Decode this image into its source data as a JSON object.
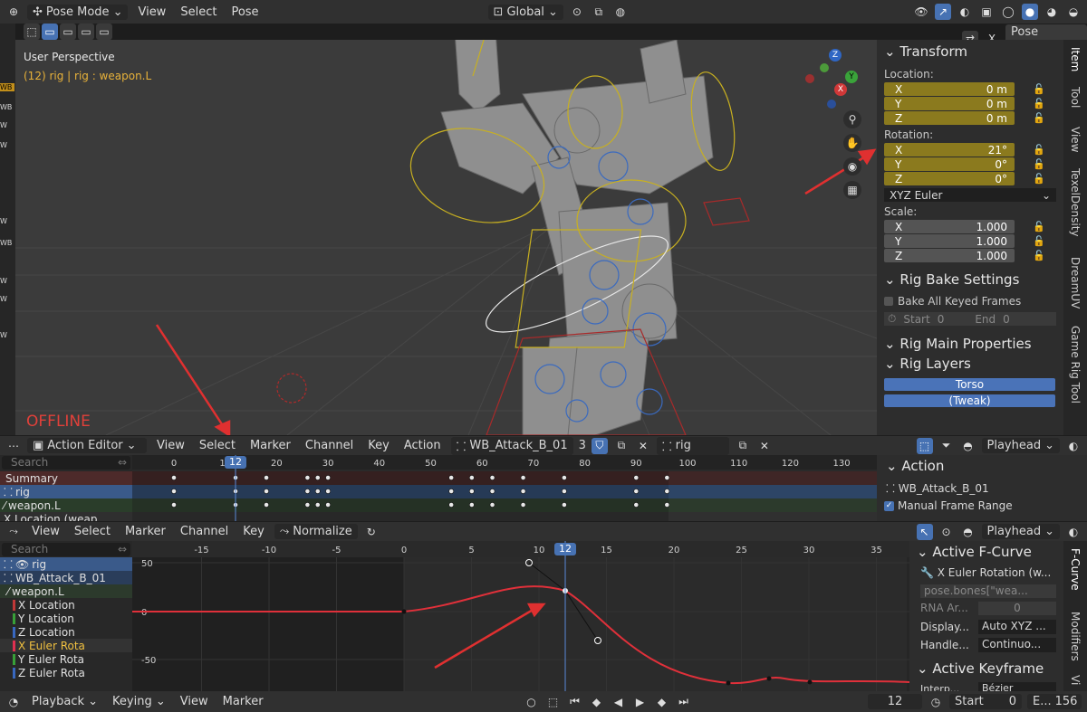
{
  "topbar": {
    "mode": "Pose Mode",
    "menus": [
      "View",
      "Select",
      "Pose"
    ],
    "orientation": "Global",
    "close_x": "X",
    "pose_options": "Pose Options"
  },
  "viewport": {
    "perspective": "User Perspective",
    "object_info": "(12) rig | rig : weapon.L",
    "offline": "OFFLINE",
    "gizmo": {
      "z": "Z",
      "x": "X",
      "y": "Y"
    }
  },
  "left_strip": [
    "WB",
    "WB",
    "W",
    "W",
    "W",
    "WB",
    "W",
    "W",
    "W"
  ],
  "properties": {
    "transform_title": "Transform",
    "location_label": "Location:",
    "location": [
      {
        "axis": "X",
        "value": "0 m"
      },
      {
        "axis": "Y",
        "value": "0 m"
      },
      {
        "axis": "Z",
        "value": "0 m"
      }
    ],
    "rotation_label": "Rotation:",
    "rotation": [
      {
        "axis": "X",
        "value": "21°"
      },
      {
        "axis": "Y",
        "value": "0°"
      },
      {
        "axis": "Z",
        "value": "0°"
      }
    ],
    "rotation_mode": "XYZ Euler",
    "scale_label": "Scale:",
    "scale": [
      {
        "axis": "X",
        "value": "1.000"
      },
      {
        "axis": "Y",
        "value": "1.000"
      },
      {
        "axis": "Z",
        "value": "1.000"
      }
    ],
    "rig_bake_title": "Rig Bake Settings",
    "bake_all": "Bake All Keyed Frames",
    "start_label": "Start",
    "start_value": "0",
    "end_label": "End",
    "end_value": "0",
    "rig_main": "Rig Main Properties",
    "rig_layers": "Rig Layers",
    "layer_buttons": [
      "Torso",
      "(Tweak)"
    ]
  },
  "side_tabs": [
    "Item",
    "Tool",
    "View",
    "TexelDensity",
    "DreamUV",
    "Game Rig Tool"
  ],
  "action_editor": {
    "editor_name": "Action Editor",
    "menus": [
      "View",
      "Select",
      "Marker",
      "Channel",
      "Key",
      "Action"
    ],
    "action_name": "WB_Attack_B_01",
    "users": "3",
    "object": "rig",
    "playhead": "Playhead",
    "search_placeholder": "Search",
    "channels": [
      "Summary",
      "rig",
      "weapon.L",
      "X Location (weap"
    ],
    "frame_ticks": [
      "0",
      "10",
      "20",
      "30",
      "40",
      "50",
      "60",
      "70",
      "80",
      "90",
      "100",
      "110",
      "120",
      "130"
    ],
    "current_frame": "12",
    "side_panel": {
      "title": "Action",
      "action": "WB_Attack_B_01",
      "manual_range": "Manual Frame Range"
    }
  },
  "graph_editor": {
    "menus": [
      "View",
      "Select",
      "Marker",
      "Channel",
      "Key"
    ],
    "normalize": "Normalize",
    "playhead": "Playhead",
    "search_placeholder": "Search",
    "channels": [
      "rig",
      "WB_Attack_B_01",
      "weapon.L",
      "X Location",
      "Y Location",
      "Z Location",
      "X Euler Rota",
      "Y Euler Rota",
      "Z Euler Rota"
    ],
    "frame_ticks": [
      "-15",
      "-10",
      "-5",
      "0",
      "5",
      "10",
      "15",
      "20",
      "25",
      "30",
      "35"
    ],
    "value_ticks": [
      "50",
      "0",
      "-50"
    ],
    "current_frame": "12",
    "side_tabs": [
      "F-Curve",
      "Modifiers",
      "Vi"
    ],
    "side_panel": {
      "title": "Active F-Curve",
      "channel": "X Euler Rotation (w...",
      "path": "pose.bones[\"wea...",
      "rna_label": "RNA Ar...",
      "rna_value": "0",
      "display_label": "Display...",
      "display_value": "Auto XYZ ...",
      "handle_label": "Handle...",
      "handle_value": "Continuo...",
      "keyframe_title": "Active Keyframe",
      "interp_label": "Interp...",
      "interp_value": "Bézier"
    }
  },
  "timeline": {
    "menus": [
      "Playback",
      "Keying",
      "View",
      "Marker"
    ],
    "frame": "12",
    "start_label": "Start",
    "start_value": "0",
    "end_label": "E...",
    "end_value": "156"
  },
  "colors": {
    "accent": "#4772b3",
    "keyed_field": "#8b7a1e",
    "curve": "#e0303a",
    "annotation_arrow": "#e03030",
    "offline": "#e0403a"
  }
}
